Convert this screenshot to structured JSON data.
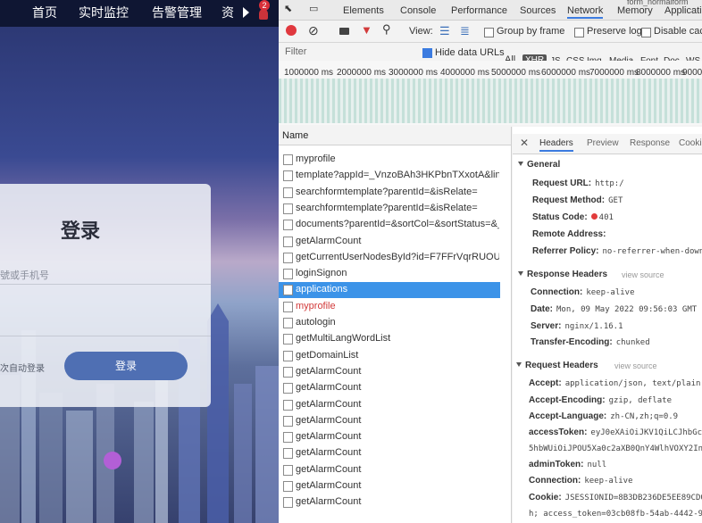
{
  "app": {
    "nav": {
      "home": "首页",
      "monitor": "实时监控",
      "alarm": "告警管理",
      "resource": "资",
      "badge": "2"
    },
    "login": {
      "title": "登录",
      "account_placeholder": "號或手机号",
      "remember": "次自动登录",
      "submit": "登录"
    }
  },
  "devtools": {
    "window_title": "form_normalform",
    "tabs": [
      "Elements",
      "Console",
      "Performance",
      "Sources",
      "Network",
      "Memory",
      "Applicatio"
    ],
    "toolbar": {
      "view_label": "View:",
      "group_by_frame": "Group by frame",
      "preserve_log": "Preserve log",
      "disable_cache": "Disable cach"
    },
    "filter": {
      "placeholder": "Filter",
      "hide_data_urls": "Hide data URLs",
      "types": [
        "All",
        "XHR",
        "JS",
        "CSS",
        "Img",
        "Media",
        "Font",
        "Doc",
        "WS"
      ]
    },
    "timeline_labels": [
      "1000000 ms",
      "2000000 ms",
      "3000000 ms",
      "4000000 ms",
      "5000000 ms",
      "6000000 ms",
      "7000000 ms",
      "8000000 ms",
      "90000"
    ],
    "requests": {
      "header": "Name",
      "rows": [
        "myprofile",
        "template?appId=_VnzoBAh3HKPbnTXxotA&linkT",
        "searchformtemplate?parentId=&isRelate=",
        "searchformtemplate?parentId=&isRelate=",
        "documents?parentId=&sortCol=&sortStatus=&_c",
        "getAlarmCount",
        "getCurrentUserNodesById?id=F7FFrVqrRUOUEhD",
        "loginSignon",
        "applications",
        "myprofile",
        "autologin",
        "getMultiLangWordList",
        "getDomainList",
        "getAlarmCount",
        "getAlarmCount",
        "getAlarmCount",
        "getAlarmCount",
        "getAlarmCount",
        "getAlarmCount",
        "getAlarmCount",
        "getAlarmCount",
        "getAlarmCount"
      ]
    },
    "details": {
      "tabs": [
        "Headers",
        "Preview",
        "Response",
        "Cooki"
      ],
      "general": {
        "title": "General",
        "request_url_k": "Request URL:",
        "request_url_v": "http:/",
        "method_k": "Request Method:",
        "method_v": "GET",
        "status_k": "Status Code:",
        "status_v": "401",
        "remote_k": "Remote Address:",
        "referrer_k": "Referrer Policy:",
        "referrer_v": "no-referrer-when-downg"
      },
      "response_headers": {
        "title": "Response Headers",
        "view_source": "view source",
        "connection_k": "Connection:",
        "connection_v": "keep-alive",
        "date_k": "Date:",
        "date_v": "Mon, 09 May 2022 09:56:03 GMT",
        "server_k": "Server:",
        "server_v": "nginx/1.16.1",
        "transfer_k": "Transfer-Encoding:",
        "transfer_v": "chunked"
      },
      "request_headers": {
        "title": "Request Headers",
        "view_source": "view source",
        "accept_k": "Accept:",
        "accept_v": "application/json, text/plain,",
        "encoding_k": "Accept-Encoding:",
        "encoding_v": "gzip, deflate",
        "language_k": "Accept-Language:",
        "language_v": "zh-CN,zh;q=0.9",
        "token_k": "accessToken:",
        "token_v": "eyJ0eXAiOiJKV1QiLCJhbGciO",
        "token_v2": "5hbWUiOiJPOU5Xa0c2aXB0QnY4WlhVOXY2In0",
        "admin_k": "adminToken:",
        "admin_v": "null",
        "conn_k": "Connection:",
        "conn_v": "keep-alive",
        "cookie_k": "Cookie:",
        "cookie_v": "JSESSIONID=8B3DB236DE5EE89CD09",
        "cookie_v2": "h; access_token=03cb08fb-54ab-4442-907"
      }
    }
  }
}
